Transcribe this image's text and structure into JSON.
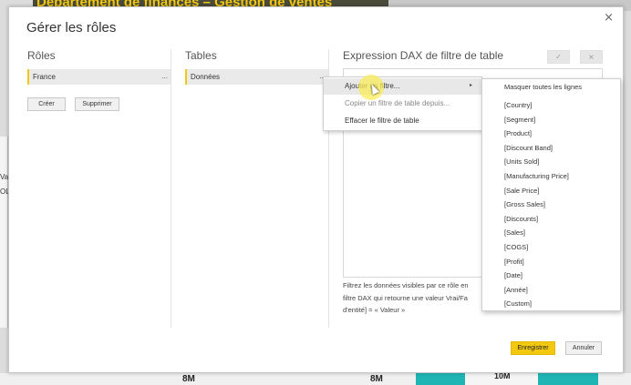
{
  "background": {
    "banner_title": "Département de finances – Gestion de ventes",
    "left_strip": [
      "Va",
      "OL"
    ],
    "bottom_values": [
      "8M",
      "8M",
      "10M"
    ]
  },
  "dialog": {
    "title": "Gérer les rôles",
    "close_glyph": "×",
    "roles": {
      "heading": "Rôles",
      "items": [
        {
          "label": "France",
          "more": "..."
        }
      ],
      "create_label": "Créer",
      "delete_label": "Supprimer"
    },
    "tables": {
      "heading": "Tables",
      "items": [
        {
          "label": "Données",
          "more": "..."
        }
      ]
    },
    "expression": {
      "heading": "Expression DAX de filtre de table",
      "check_glyph": "✓",
      "cancel_glyph": "×",
      "help_lines": [
        "Filtrez les données visibles par ce rôle en",
        "filtre DAX qui retourne une valeur Vrai/Fa",
        "d'entité] = « Valeur »"
      ]
    },
    "save_label": "Enregistrer",
    "cancel_label": "Annuler"
  },
  "context_menu": {
    "items": [
      {
        "label": "Ajouter un filtre...",
        "arrow": "▸"
      },
      {
        "label": "Copier un filtre de table depuis..."
      },
      {
        "label": "Effacer le filtre de table"
      }
    ]
  },
  "submenu": {
    "items": [
      "Masquer toutes les lignes",
      "[Country]",
      "[Segment]",
      "[Product]",
      "[Discount Band]",
      "[Units Sold]",
      "[Manufacturing Price]",
      "[Sale Price]",
      "[Gross Sales]",
      "[Discounts]",
      "[Sales]",
      "[COGS]",
      "[Profit]",
      "[Date]",
      "[Année]",
      "[Custom]"
    ]
  }
}
